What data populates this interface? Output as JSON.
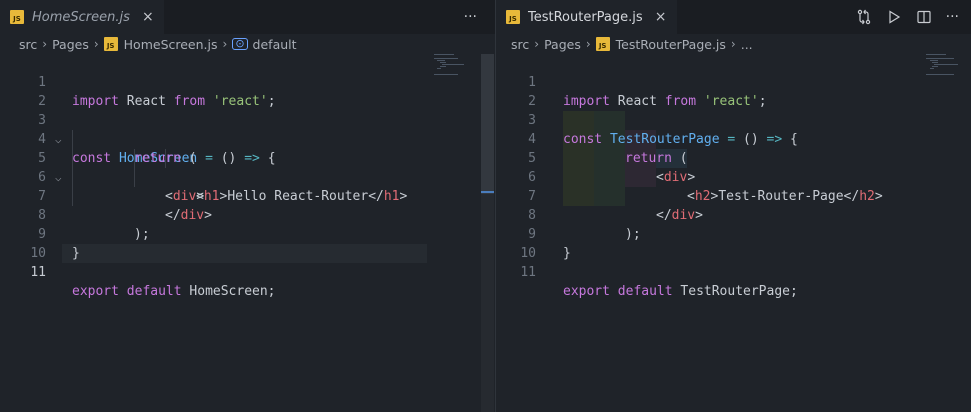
{
  "left": {
    "tab": {
      "icon": "js-file-icon",
      "icon_text": "JS",
      "label": "HomeScreen.js",
      "close": "×"
    },
    "more_actions": "···",
    "breadcrumb": {
      "items": [
        "src",
        "Pages",
        "HomeScreen.js",
        "default"
      ],
      "symbol_icon": "symbol-variable-icon",
      "symbol_icon_text": "[⊙]"
    },
    "lines": [
      {
        "n": "1"
      },
      {
        "n": "2"
      },
      {
        "n": "3"
      },
      {
        "n": "4"
      },
      {
        "n": "5"
      },
      {
        "n": "6"
      },
      {
        "n": "7"
      },
      {
        "n": "8"
      },
      {
        "n": "9"
      },
      {
        "n": "10"
      },
      {
        "n": "11"
      }
    ],
    "active_line": "11",
    "fold_markers": [
      "3",
      "5"
    ]
  },
  "right": {
    "tab": {
      "icon": "js-file-icon",
      "icon_text": "JS",
      "label": "TestRouterPage.js",
      "close": "×"
    },
    "actions": [
      "git-compare-icon",
      "run-icon",
      "split-editor-icon",
      "more-actions-icon"
    ],
    "more_actions": "···",
    "breadcrumb": {
      "items": [
        "src",
        "Pages",
        "TestRouterPage.js",
        "..."
      ]
    },
    "lines": [
      {
        "n": "1"
      },
      {
        "n": "2"
      },
      {
        "n": "3"
      },
      {
        "n": "4"
      },
      {
        "n": "5"
      },
      {
        "n": "6"
      },
      {
        "n": "7"
      },
      {
        "n": "8"
      },
      {
        "n": "9"
      },
      {
        "n": "10"
      },
      {
        "n": "11"
      }
    ]
  },
  "code_left": {
    "l1": [
      "import",
      " React ",
      "from",
      " ",
      "'react'",
      ";"
    ],
    "l3": [
      "const",
      " ",
      "HomeScreen",
      " ",
      "=",
      " () ",
      "=>",
      " {"
    ],
    "l4": [
      "return",
      " ("
    ],
    "l5": [
      "<",
      "div",
      ">"
    ],
    "l6": [
      "<",
      "h1",
      ">",
      "Hello React-Router",
      "</",
      "h1",
      ">"
    ],
    "l7": [
      "</",
      "div",
      ">"
    ],
    "l8": [
      ");"
    ],
    "l9": [
      "}"
    ],
    "l11": [
      "export",
      " ",
      "default",
      " HomeScreen;"
    ]
  },
  "code_right": {
    "l1": [
      "import",
      " React ",
      "from",
      " ",
      "'react'",
      ";"
    ],
    "l3": [
      "const",
      " ",
      "TestRouterPage",
      " ",
      "=",
      " () ",
      "=>",
      " {"
    ],
    "l4": [
      "return",
      " ("
    ],
    "l5": [
      "<",
      "div",
      ">"
    ],
    "l6": [
      "<",
      "h2",
      ">",
      "Test-Router-Page",
      "</",
      "h2",
      ">"
    ],
    "l7": [
      "</",
      "div",
      ">"
    ],
    "l8": [
      ");"
    ],
    "l9": [
      "}"
    ],
    "l11": [
      "export",
      " ",
      "default",
      " TestRouterPage;"
    ]
  },
  "colors": {
    "background": "#1f2329",
    "keyword": "#c678dd",
    "string": "#98c379",
    "function": "#61afef",
    "tag": "#e06c75",
    "operator": "#56b6c2",
    "js_icon": "#e8b93a"
  }
}
